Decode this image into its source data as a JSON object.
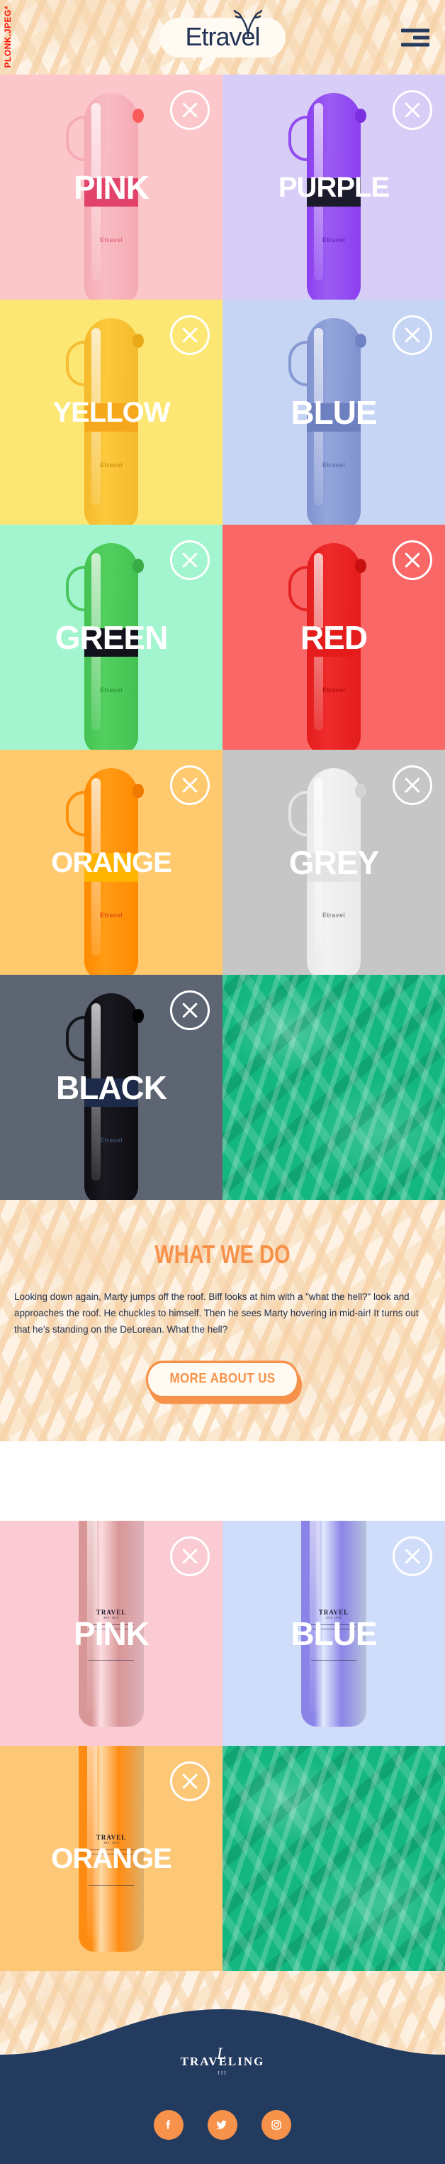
{
  "watermark": "PLONK.JPEG*",
  "header": {
    "logo_text": "Etravel",
    "menu_icon": "hamburger-menu-icon"
  },
  "product_grid_1": {
    "close_icon": "close-x-icon",
    "brand_mark": "Etravel",
    "tiles": [
      {
        "label": "PINK",
        "bg": "#fbc7cb",
        "bottle": "#f4aab4",
        "cap": "#f9bcc4",
        "band": "#e2436b",
        "nub": "#fb5b5b",
        "brand_color": "#e4707f"
      },
      {
        "label": "PURPLE",
        "bg": "#d8cdf7",
        "bottle": "#8b3ff0",
        "cap": "#9b5cf2",
        "band": "#1b1b2b",
        "nub": "#7b2fe0",
        "brand_color": "#6b28c8"
      },
      {
        "label": "YELLOW",
        "bg": "#fde774",
        "bottle": "#f5b92b",
        "cap": "#fcc93d",
        "band": "#f5a81c",
        "nub": "#e9a919",
        "brand_color": "#d49412"
      },
      {
        "label": "BLUE",
        "bg": "#c5d5f3",
        "bottle": "#8093cf",
        "cap": "#94a5dc",
        "band": "#6d80c0",
        "nub": "#6f83c4",
        "brand_color": "#5d6fae"
      },
      {
        "label": "GREEN",
        "bg": "#a2f5ce",
        "bottle": "#43c252",
        "cap": "#52cf5f",
        "band": "#12121c",
        "nub": "#38ab44",
        "brand_color": "#2e9a3c"
      },
      {
        "label": "RED",
        "bg": "#fa6767",
        "bottle": "#e41c1c",
        "cap": "#ef2b2b",
        "band": "#e41c1c",
        "nub": "#c81010",
        "brand_color": "#b80e0e"
      },
      {
        "label": "ORANGE",
        "bg": "#ffc96e",
        "bottle": "#ff8a00",
        "cap": "#ff9c15",
        "band": "#ffb400",
        "nub": "#f07a00",
        "brand_color": "#e04f12"
      },
      {
        "label": "GREY",
        "bg": "#c6c6c6",
        "bottle": "#e9e9e9",
        "cap": "#f2f2f2",
        "band": "#e3e3e3",
        "nub": "#d4d4d4",
        "brand_color": "#8d8d8d"
      },
      {
        "label": "BLACK",
        "bg": "#5d6472",
        "bottle": "#0d0d12",
        "cap": "#18181f",
        "band": "#1d2a4a",
        "nub": "#000000",
        "brand_color": "#3b4a6b"
      }
    ],
    "filler_tile": {
      "style": "green-marble",
      "color": "#14b780"
    }
  },
  "what_we_do": {
    "title": "WHAT WE DO",
    "body": "Looking down again, Marty jumps off the roof. Biff looks at him with a \"what the hell?\" look and approaches the roof. He chuckles to himself. Then he sees Marty hovering in mid-air! It turns out that he's standing on the DeLorean. What the hell?",
    "button_label": "MORE ABOUT US"
  },
  "product_grid_2": {
    "close_icon": "close-x-icon",
    "brand_mark": "TRAVEL",
    "brand_submark": "EST. 1970",
    "tiles": [
      {
        "label": "PINK",
        "bg": "#fbcbd3",
        "bottle": "#d99697"
      },
      {
        "label": "BLUE",
        "bg": "#cfddfa",
        "bottle": "#8b84e8"
      },
      {
        "label": "ORANGE",
        "bg": "#fcc878",
        "bottle": "#ff8c12"
      }
    ],
    "filler_tile": {
      "style": "green-marble",
      "color": "#14b780"
    }
  },
  "footer": {
    "logo_main": "TRAVELING",
    "logo_script": "L",
    "logo_sub": "III",
    "wave_color": "#243b60",
    "accent_color": "#f7924a",
    "socials": [
      {
        "name": "facebook-icon",
        "label": "Facebook"
      },
      {
        "name": "twitter-icon",
        "label": "Twitter"
      },
      {
        "name": "instagram-icon",
        "label": "Instagram"
      }
    ]
  }
}
